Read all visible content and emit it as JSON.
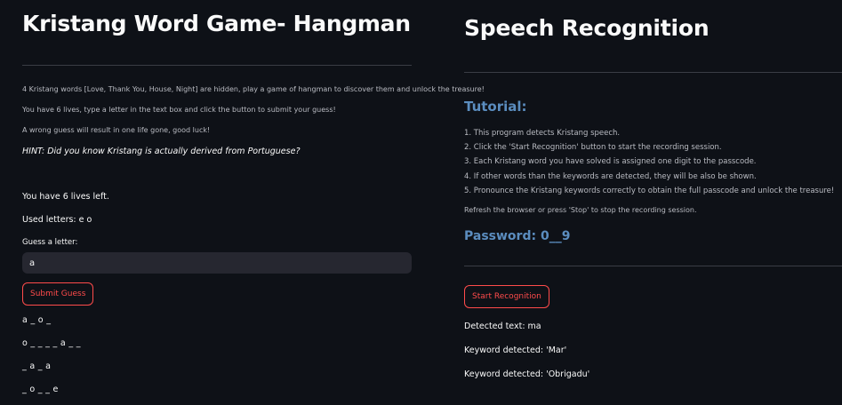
{
  "hangman": {
    "title": "Kristang Word Game- Hangman",
    "intro": "4 Kristang words [Love, Thank You, House, Night] are hidden, play a game of hangman to discover them and unlock the treasure!",
    "lives_info": "You have 6 lives, type a letter in the text box and click the button to submit your guess!",
    "warning": "A wrong guess will result in one life gone, good luck!",
    "hint": "HINT: Did you know Kristang is actually derived from Portuguese?",
    "lives_left": "You have 6 lives left.",
    "used_letters": "Used letters: e o",
    "guess_label": "Guess a letter:",
    "guess_value": "a",
    "submit_label": "Submit Guess",
    "words": [
      "a _ o _",
      "o _ _ _ _ a _ _",
      "_ a _ a",
      "_ o _ _ e"
    ]
  },
  "speech": {
    "title": "Speech Recognition",
    "tutorial_title": "Tutorial:",
    "steps": [
      "1. This program detects Kristang speech.",
      "2. Click the 'Start Recognition' button to start the recording session.",
      "3. Each Kristang word you have solved is assigned one digit to the passcode.",
      "4. If other words than the keywords are detected, they will be also be shown.",
      "5. Pronounce the Kristang keywords correctly to obtain the full passcode and unlock the treasure!"
    ],
    "refresh_note": "Refresh the browser or press 'Stop' to stop the recording session.",
    "password": "Password: 0__9",
    "start_label": "Start Recognition",
    "detected_text": "Detected text: ma",
    "keywords": [
      "Keyword detected: 'Mar'",
      "Keyword detected: 'Obrigadu'"
    ]
  },
  "colors": {
    "background": "#0e1117",
    "accent_red": "#ff4b4b",
    "heading_blue": "#5b8dbf",
    "input_bg": "#262730"
  }
}
